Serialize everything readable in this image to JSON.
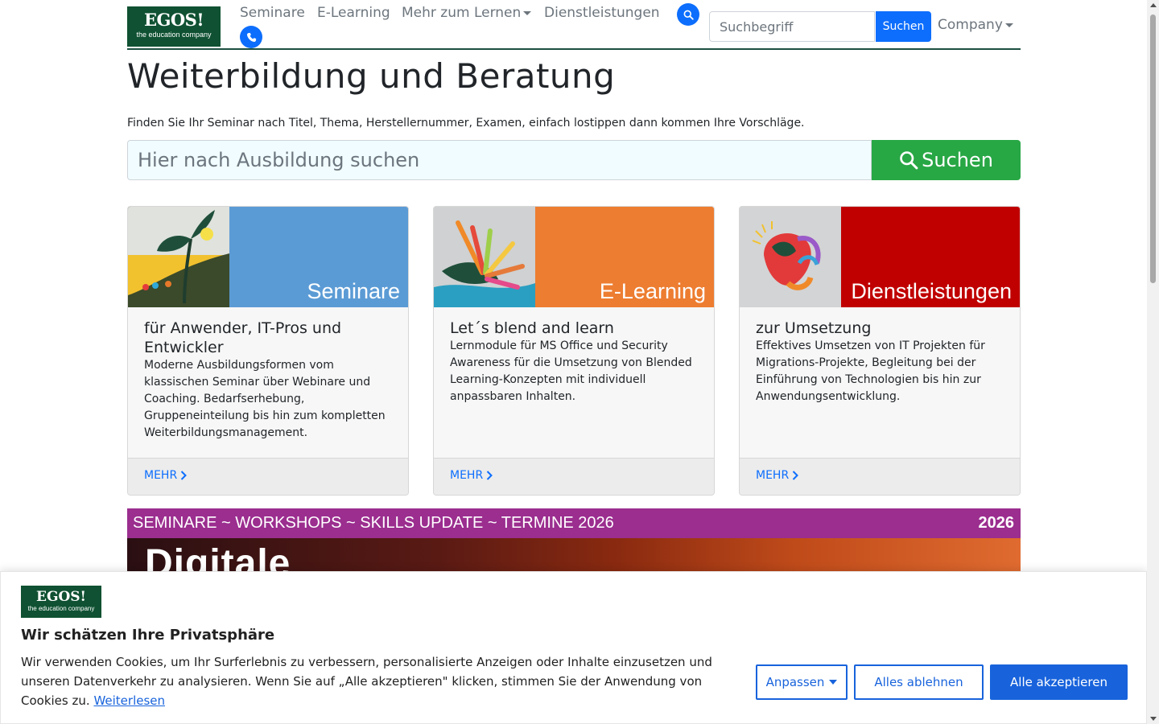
{
  "nav": {
    "logo_line1": "EGOS!",
    "logo_line2": "the education company",
    "items": [
      {
        "label": "Seminare"
      },
      {
        "label": "E-Learning"
      },
      {
        "label": "Mehr zum Lernen"
      },
      {
        "label": "Dienstleistungen"
      }
    ],
    "search_placeholder": "Suchbegriff",
    "search_button": "Suchen",
    "company_label": "Company",
    "icons": [
      "search-icon",
      "phone-icon"
    ]
  },
  "hero": {
    "title": "Weiterbildung und Beratung",
    "subtitle": "Finden Sie Ihr Seminar nach Titel, Thema, Herstellernummer, Examen, einfach lostippen dann kommen Ihre Vorschläge.",
    "search_placeholder": "Hier nach Ausbildung suchen",
    "search_button": "Suchen"
  },
  "cards": [
    {
      "image_label": "Seminare",
      "panel_color": "#5b9bd5",
      "title": "für Anwender, IT-Pros und Entwickler",
      "text": "Moderne Ausbildungsformen vom klassischen Seminar über Webinare und Coaching. Bedarfserhebung, Gruppeneinteilung bis hin zum kompletten Weiterbildungsmanagement.",
      "more": "MEHR"
    },
    {
      "image_label": "E-Learning",
      "panel_color": "#ed7d31",
      "title": "Let´s blend and learn",
      "text": "Lernmodule für MS Office und Security Awareness für die Umsetzung von Blended Learning-Konzepten mit individuell anpassbaren Inhalten.",
      "more": "MEHR"
    },
    {
      "image_label": "Dienstleistungen",
      "panel_color": "#c00000",
      "title": "zur Umsetzung",
      "text": "Effektives Umsetzen von IT Projekten für Migrations-Projekte, Begleitung bei der Einführung von Technologien bis hin zur Anwendungsentwicklung.",
      "more": "MEHR"
    }
  ],
  "banner": {
    "top_left": "SEMINARE ~ WORKSHOPS ~ SKILLS UPDATE ~ TERMINE 2026",
    "top_right": "2026",
    "headline": "Digitale"
  },
  "cookie": {
    "logo_line1": "EGOS!",
    "logo_line2": "the education company",
    "title": "Wir schätzen Ihre Privatsphäre",
    "text": "Wir verwenden Cookies, um Ihr Surferlebnis zu verbessern, personalisierte Anzeigen oder Inhalte einzusetzen und unseren Datenverkehr zu analysieren. Wenn Sie auf „Alle akzeptieren\" klicken, stimmen Sie der Anwendung von Cookies zu.",
    "read_more": "Weiterlesen",
    "customize": "Anpassen",
    "reject": "Alles ablehnen",
    "accept": "Alle akzeptieren",
    "accent": "#1863dc"
  }
}
